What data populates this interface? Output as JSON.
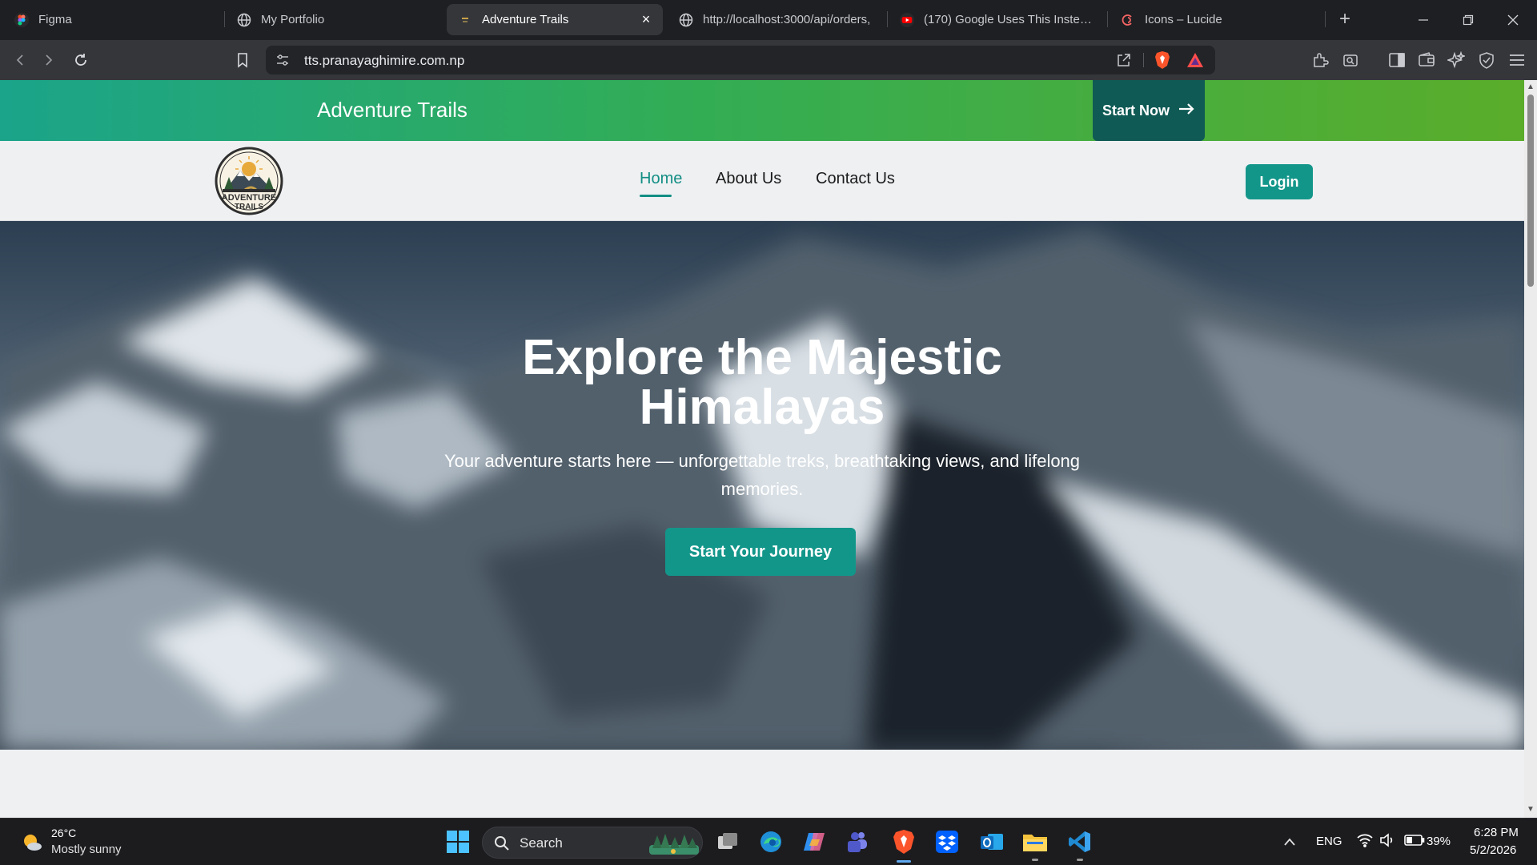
{
  "browser": {
    "tabs": [
      {
        "title": "Figma",
        "icon": "figma-icon"
      },
      {
        "title": "My Portfolio",
        "icon": "globe-icon"
      },
      {
        "title": "Adventure Trails",
        "icon": "site-icon",
        "active": true
      },
      {
        "title": "http://localhost:3000/api/orders,",
        "icon": "globe-icon"
      },
      {
        "title": "(170) Google Uses This Instead o",
        "icon": "youtube-icon"
      },
      {
        "title": "Icons – Lucide",
        "icon": "lucide-icon"
      }
    ],
    "address": "tts.pranayaghimire.com.np"
  },
  "site": {
    "topbar_title": "Adventure Trails",
    "start_now": "Start Now",
    "logo_line1": "ADVENTURE",
    "logo_line2": "TRAILS",
    "nav": {
      "home": "Home",
      "about": "About Us",
      "contact": "Contact Us",
      "active": "Home"
    },
    "login": "Login",
    "hero": {
      "title_line1": "Explore the Majestic",
      "title_line2": "Himalayas",
      "subtitle": "Your adventure starts here — unforgettable treks, breathtaking views, and lifelong memories.",
      "cta": "Start Your Journey"
    }
  },
  "colors": {
    "accent": "#13968a",
    "dark_teal": "#0f5a55",
    "topbar_gradient_start": "#1ba48a",
    "topbar_gradient_end": "#5aad2a"
  },
  "taskbar": {
    "weather_temp": "26°C",
    "weather_desc": "Mostly sunny",
    "search": "Search",
    "language": "ENG",
    "battery": "39%",
    "time": "6:28 PM",
    "date": "5/2/2026"
  }
}
